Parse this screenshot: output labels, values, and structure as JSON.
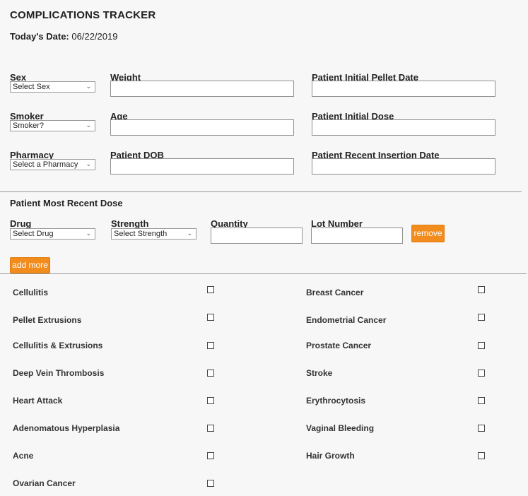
{
  "header": {
    "title": "COMPLICATIONS TRACKER",
    "date_label": "Today's Date:",
    "date_value": "06/22/2019"
  },
  "fields": {
    "sex": {
      "label": "Sex",
      "value": "Select Sex"
    },
    "weight": {
      "label": "Weight",
      "value": ""
    },
    "initial_pellet_date": {
      "label": "Patient Initial Pellet Date",
      "value": ""
    },
    "smoker": {
      "label": "Smoker",
      "value": "Smoker?"
    },
    "age": {
      "label": "Age",
      "value": ""
    },
    "initial_dose": {
      "label": "Patient Initial Dose",
      "value": ""
    },
    "pharmacy": {
      "label": "Pharmacy",
      "value": "Select a Pharmacy"
    },
    "dob": {
      "label": "Patient DOB",
      "value": ""
    },
    "recent_insertion_date": {
      "label": "Patient Recent Insertion Date",
      "value": ""
    }
  },
  "dose": {
    "heading": "Patient Most Recent Dose",
    "drug": {
      "label": "Drug",
      "value": "Select Drug"
    },
    "strength": {
      "label": "Strength",
      "value": "Select Strength"
    },
    "quantity": {
      "label": "Quantity",
      "value": ""
    },
    "lot": {
      "label": "Lot Number",
      "value": ""
    },
    "remove_label": "remove",
    "add_label": "add more"
  },
  "complications": {
    "left": [
      "Cellulitis",
      "Pellet Extrusions",
      "Cellulitis & Extrusions",
      "Deep Vein Thrombosis",
      "Heart Attack",
      "Adenomatous Hyperplasia",
      "Acne",
      "Ovarian Cancer"
    ],
    "right": [
      "Breast Cancer",
      "Endometrial Cancer",
      "Prostate Cancer",
      "Stroke",
      "Erythrocytosis",
      "Vaginal Bleeding",
      "Hair Growth"
    ]
  }
}
